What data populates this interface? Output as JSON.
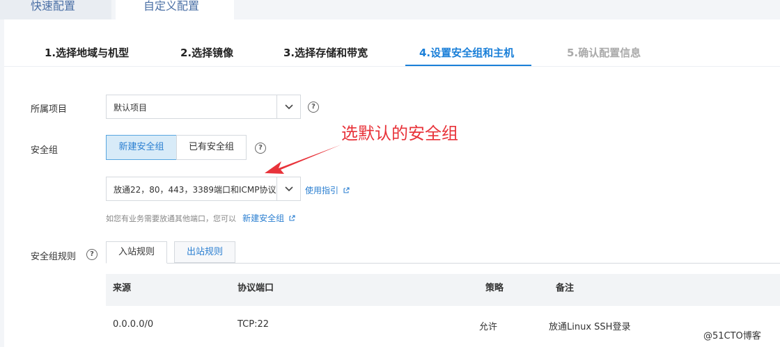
{
  "mode_tabs": {
    "quick": "快速配置",
    "custom": "自定义配置"
  },
  "steps": [
    {
      "label": "1.选择地域与机型",
      "state": "done"
    },
    {
      "label": "2.选择镜像",
      "state": "done"
    },
    {
      "label": "3.选择存储和带宽",
      "state": "done"
    },
    {
      "label": "4.设置安全组和主机",
      "state": "active"
    },
    {
      "label": "5.确认配置信息",
      "state": "disabled"
    }
  ],
  "project": {
    "label": "所属项目",
    "value": "默认项目"
  },
  "security_group": {
    "label": "安全组",
    "new_option": "新建安全组",
    "existing_option": "已有安全组",
    "selected": "放通22，80，443，3389端口和ICMP协议",
    "guide_link": "使用指引",
    "hint": "如您有业务需要放通其他端口，您可以",
    "hint_link": "新建安全组"
  },
  "rules": {
    "label": "安全组规则",
    "tabs": [
      "入站规则",
      "出站规则"
    ],
    "columns": [
      "来源",
      "协议端口",
      "策略",
      "备注"
    ],
    "rows": [
      {
        "source": "0.0.0.0/0",
        "port": "TCP:22",
        "policy": "允许",
        "note": "放通Linux SSH登录"
      }
    ]
  },
  "annotation": "选默认的安全组",
  "watermark": "@51CTO博客",
  "colors": {
    "accent": "#1a7fd8",
    "annotation": "#e8333a"
  }
}
